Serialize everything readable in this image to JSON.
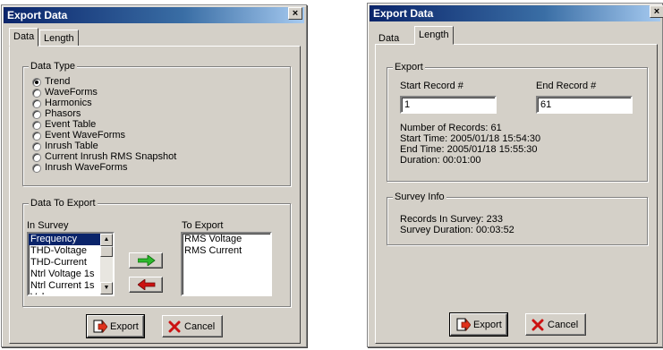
{
  "dialog1": {
    "title": "Export Data",
    "close": "×",
    "tabs": [
      "Data",
      "Length"
    ],
    "data_type": {
      "legend": "Data Type",
      "options": [
        {
          "label": "Trend",
          "checked": true
        },
        {
          "label": "WaveForms",
          "checked": false
        },
        {
          "label": "Harmonics",
          "checked": false
        },
        {
          "label": "Phasors",
          "checked": false
        },
        {
          "label": "Event Table",
          "checked": false
        },
        {
          "label": "Event WaveForms",
          "checked": false
        },
        {
          "label": "Inrush Table",
          "checked": false
        },
        {
          "label": "Current Inrush RMS Snapshot",
          "checked": false
        },
        {
          "label": "Inrush WaveForms",
          "checked": false
        }
      ]
    },
    "data_to_export": {
      "legend": "Data To Export",
      "in_survey_label": "In Survey",
      "to_export_label": "To Export",
      "in_survey": [
        "Frequency",
        "THD-Voltage",
        "THD-Current",
        "Ntrl Voltage 1s",
        "Ntrl Current 1s",
        "Vol"
      ],
      "to_export": [
        "RMS Voltage",
        "RMS Current"
      ]
    },
    "export_label": "Export",
    "cancel_label": "Cancel"
  },
  "dialog2": {
    "title": "Export Data",
    "close": "×",
    "tabs": [
      "Data",
      "Length"
    ],
    "export_group": {
      "legend": "Export",
      "start_label": "Start Record #",
      "end_label": "End Record #",
      "start_value": "1",
      "end_value": "61",
      "num_records": "Number of Records: 61",
      "start_time": "Start Time: 2005/01/18 15:54:30",
      "end_time": "End Time: 2005/01/18 15:55:30",
      "duration": "Duration: 00:01:00"
    },
    "survey_info": {
      "legend": "Survey Info",
      "records": "Records In Survey: 233",
      "survey_duration": "Survey Duration: 00:03:52"
    },
    "export_label": "Export",
    "cancel_label": "Cancel"
  },
  "colors": {
    "titlebar": "#0a246a",
    "face": "#d4d0c8",
    "selection": "#0a246a",
    "add_arrow": "#2db82d",
    "remove_arrow": "#cc1111",
    "cancel_x": "#cc1111"
  },
  "icons": [
    "close-icon",
    "export-icon",
    "cancel-x-icon",
    "add-arrow-icon",
    "remove-arrow-icon",
    "scroll-up-icon",
    "scroll-down-icon"
  ]
}
